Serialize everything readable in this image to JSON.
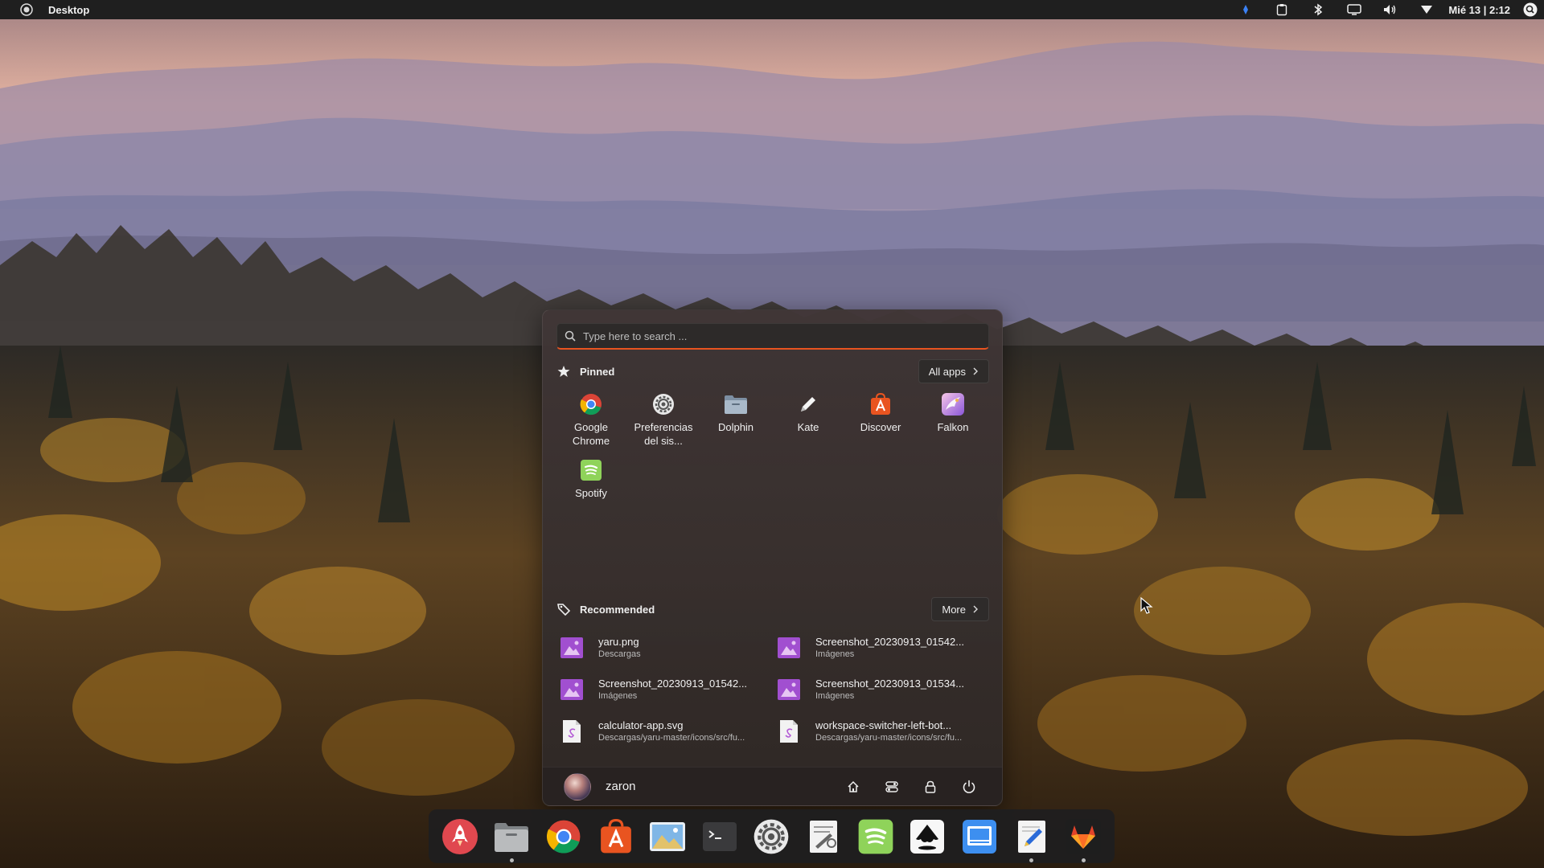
{
  "topbar": {
    "title": "Desktop",
    "clock": "Mié 13 | 2:12",
    "tray_icons": [
      "activities-icon",
      "network-icon",
      "clipboard-icon",
      "bluetooth-icon",
      "display-icon",
      "volume-icon",
      "wifi-icon",
      "search-icon"
    ]
  },
  "launcher": {
    "search": {
      "placeholder": "Type here to search ..."
    },
    "pinned": {
      "title": "Pinned",
      "all_apps_label": "All apps",
      "apps": [
        {
          "name": "Google Chrome",
          "icon": "chrome-icon"
        },
        {
          "name": "Preferencias del sis...",
          "icon": "settings-gear-icon"
        },
        {
          "name": "Dolphin",
          "icon": "folder-icon"
        },
        {
          "name": "Kate",
          "icon": "pencil-icon"
        },
        {
          "name": "Discover",
          "icon": "discover-store-icon"
        },
        {
          "name": "Falkon",
          "icon": "falkon-icon"
        },
        {
          "name": "Spotify",
          "icon": "spotify-icon"
        }
      ]
    },
    "recommended": {
      "title": "Recommended",
      "more_label": "More",
      "items": [
        {
          "name": "yaru.png",
          "path": "Descargas",
          "icon": "image-file-icon"
        },
        {
          "name": "Screenshot_20230913_01542...",
          "path": "Imágenes",
          "icon": "image-file-icon"
        },
        {
          "name": "Screenshot_20230913_01542...",
          "path": "Imágenes",
          "icon": "image-file-icon"
        },
        {
          "name": "Screenshot_20230913_01534...",
          "path": "Imágenes",
          "icon": "image-file-icon"
        },
        {
          "name": "calculator-app.svg",
          "path": "Descargas/yaru-master/icons/src/fu...",
          "icon": "svg-file-icon"
        },
        {
          "name": "workspace-switcher-left-bot...",
          "path": "Descargas/yaru-master/icons/src/fu...",
          "icon": "svg-file-icon"
        }
      ]
    },
    "user": {
      "name": "zaron",
      "actions": [
        "home-icon",
        "settings-toggle-icon",
        "lock-icon",
        "power-icon"
      ]
    }
  },
  "dock": {
    "items": [
      {
        "icon": "launcher-rocket-icon",
        "running": false
      },
      {
        "icon": "files-icon",
        "running": true
      },
      {
        "icon": "chrome-icon",
        "running": false
      },
      {
        "icon": "software-store-icon",
        "running": false
      },
      {
        "icon": "image-viewer-icon",
        "running": false
      },
      {
        "icon": "terminal-icon",
        "running": false
      },
      {
        "icon": "system-settings-icon",
        "running": false
      },
      {
        "icon": "system-tools-icon",
        "running": false
      },
      {
        "icon": "spotify-icon",
        "running": false
      },
      {
        "icon": "inkscape-icon",
        "running": false
      },
      {
        "icon": "screenshot-tool-icon",
        "running": false
      },
      {
        "icon": "text-editor-icon",
        "running": true
      },
      {
        "icon": "gitlab-icon",
        "running": true
      }
    ]
  },
  "colors": {
    "accent": "#e95420",
    "panel": "#1f1f1f",
    "launcher_bg": "#3a3231"
  }
}
